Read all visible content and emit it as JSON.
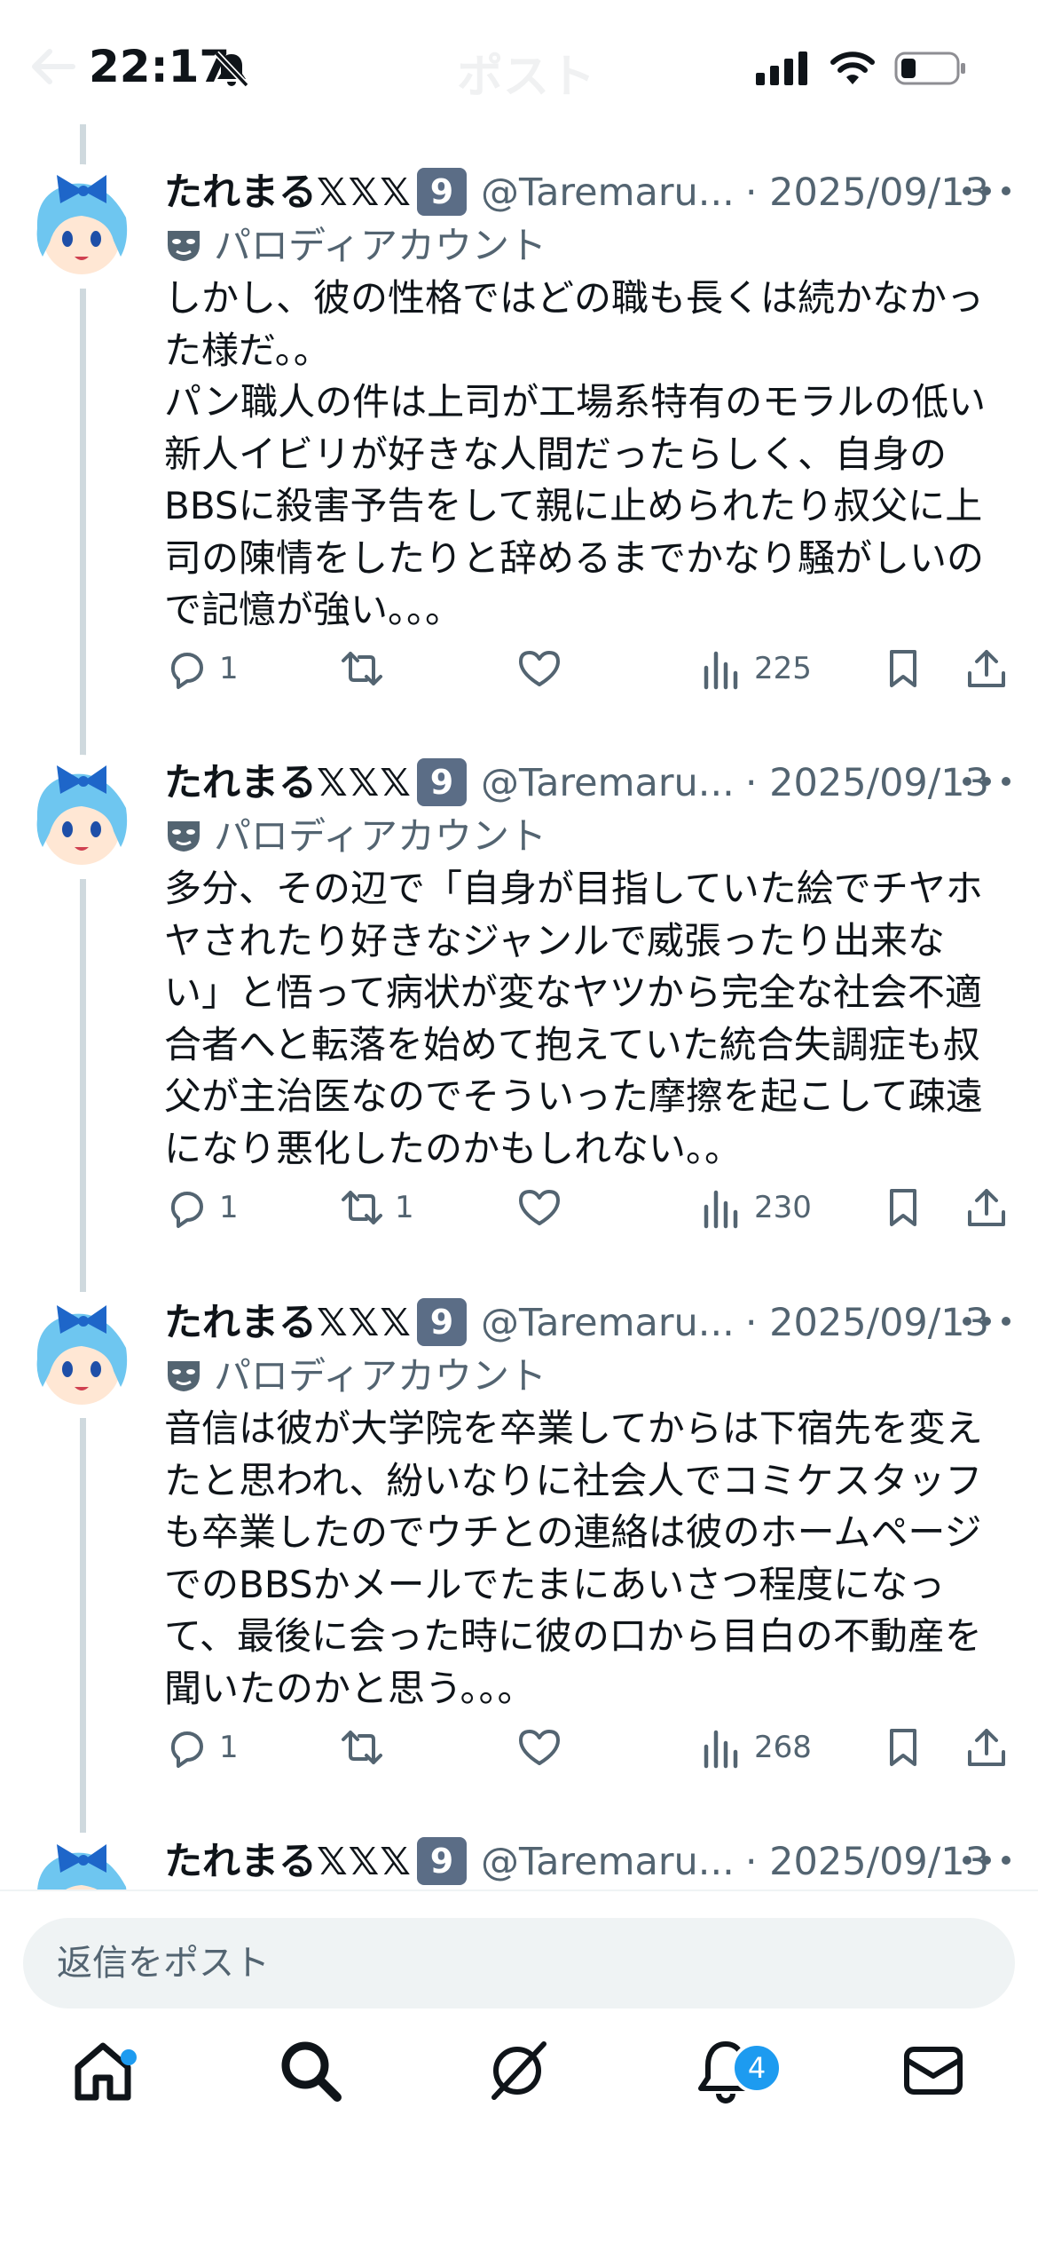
{
  "status_bar": {
    "time": "22:17"
  },
  "header": {
    "title": "ポスト"
  },
  "posts": [
    {
      "author": {
        "name": "たれまる",
        "suffix": "𝕏𝕏𝕏",
        "badge": "9",
        "handle": "@Taremaru...",
        "date": "· 2025/09/13",
        "label": "パロディアカウント"
      },
      "text": "しかし、彼の性格ではどの職も長くは続かなかった様だ。。\nパン職人の件は上司が工場系特有のモラルの低い新人イビリが好きな人間だったらしく、自身のBBSに殺害予告をして親に止められたり叔父に上司の陳情をしたりと辞めるまでかなり騒がしいので記憶が強い。。。",
      "replies": "1",
      "reposts": "",
      "likes": "",
      "views": "225"
    },
    {
      "author": {
        "name": "たれまる",
        "suffix": "𝕏𝕏𝕏",
        "badge": "9",
        "handle": "@Taremaru...",
        "date": "· 2025/09/13",
        "label": "パロディアカウント"
      },
      "text": "多分、その辺で「自身が目指していた絵でチヤホヤされたり好きなジャンルで威張ったり出来ない」と悟って病状が変なヤツから完全な社会不適合者へと転落を始めて抱えていた統合失調症も叔父が主治医なのでそういった摩擦を起こして疎遠になり悪化したのかもしれない。。",
      "replies": "1",
      "reposts": "1",
      "likes": "",
      "views": "230"
    },
    {
      "author": {
        "name": "たれまる",
        "suffix": "𝕏𝕏𝕏",
        "badge": "9",
        "handle": "@Taremaru...",
        "date": "· 2025/09/13",
        "label": "パロディアカウント"
      },
      "text": "音信は彼が大学院を卒業してからは下宿先を変えたと思われ、紛いなりに社会人でコミケスタッフも卒業したのでウチとの連絡は彼のホームページでのBBSかメールでたまにあいさつ程度になって、最後に会った時に彼の口から目白の不動産を聞いたのかと思う。。。",
      "replies": "1",
      "reposts": "",
      "likes": "",
      "views": "268"
    },
    {
      "author": {
        "name": "たれまる",
        "suffix": "𝕏𝕏𝕏",
        "badge": "9",
        "handle": "@Taremaru...",
        "date": "· 2025/09/13"
      }
    }
  ],
  "reply_bar": {
    "placeholder": "返信をポスト"
  },
  "nav": {
    "notifications_badge": "4"
  },
  "icons": [
    "back-arrow-icon",
    "bell-off-icon",
    "signal-icon",
    "wifi-icon",
    "battery-icon",
    "more-icon",
    "mask-icon",
    "reply-icon",
    "repost-icon",
    "like-icon",
    "views-icon",
    "bookmark-icon",
    "share-icon",
    "home-icon",
    "search-icon",
    "grok-icon",
    "bell-icon",
    "mail-icon"
  ],
  "colors": {
    "accent": "#1d9bf0",
    "text": "#0f1419",
    "secondary": "#536471",
    "thread_line": "#cfd9de",
    "badge": "#5b6d86"
  }
}
